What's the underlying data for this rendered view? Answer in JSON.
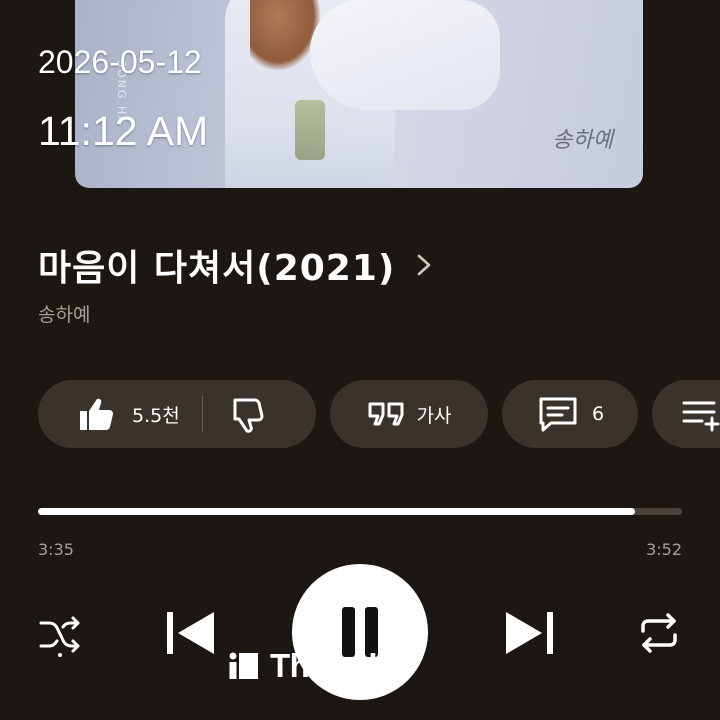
{
  "album_art": {
    "signature": "송하예",
    "vertical_text": "SONG HA"
  },
  "overlay": {
    "date": "2026-05-12",
    "time": "11:12 AM"
  },
  "song": {
    "title": "마음이 다쳐서(2021)",
    "artist": "송하예"
  },
  "actions": {
    "like_count": "5.5천",
    "lyrics_label": "가사",
    "comment_count": "6"
  },
  "progress": {
    "elapsed": "3:35",
    "total": "3:52",
    "fraction": 0.927
  },
  "watermark": {
    "text": "Threads"
  },
  "colors": {
    "background": "#1c1712",
    "chip": "#3a332c",
    "secondary_text": "#a69f96"
  }
}
